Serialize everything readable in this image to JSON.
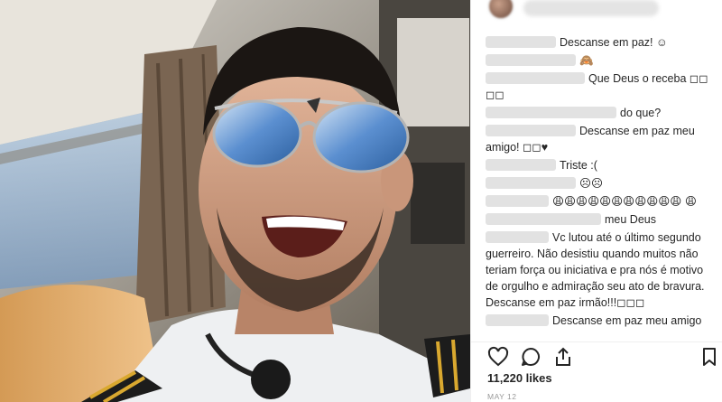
{
  "post": {
    "likes": "11,220 likes",
    "date": "MAY 12"
  },
  "comments": [
    {
      "text": "Descanse em paz! ☺",
      "blur_w": 78,
      "indent": 0
    },
    {
      "text": "🙈",
      "blur_w": 100,
      "indent": 0
    },
    {
      "text": "Que Deus o receba ◻◻ ◻◻",
      "blur_w": 110,
      "indent": 0
    },
    {
      "text": "do que?",
      "blur_w": 145,
      "indent": 0
    },
    {
      "text": "Descanse em paz meu amigo! ◻◻♥",
      "blur_w": 100,
      "indent": 0
    },
    {
      "text": "Triste :(",
      "blur_w": 78,
      "indent": 0
    },
    {
      "text": "☹☹",
      "blur_w": 100,
      "indent": 0
    },
    {
      "text": "😩😩😩😩😩😩😩😩😩😩😩 😩",
      "blur_w": 70,
      "indent": 0
    },
    {
      "text": "meu Deus",
      "blur_w": 128,
      "indent": 0
    },
    {
      "text": "Vc lutou até o último segundo guerreiro. Não desistiu quando muitos não teriam força ou iniciativa e pra nós é motivo de orgulho e admiração seu ato de bravura. Descanse em paz irmão!!!◻◻◻",
      "blur_w": 70,
      "indent": 0
    },
    {
      "text": "Descanse em paz meu amigo",
      "blur_w": 70,
      "indent": 0
    }
  ],
  "icons": {
    "like": "heart-icon",
    "comment": "comment-icon",
    "share": "share-icon",
    "save": "bookmark-icon"
  },
  "colors": {
    "text": "#262626",
    "muted": "#999999",
    "border": "#efefef"
  }
}
